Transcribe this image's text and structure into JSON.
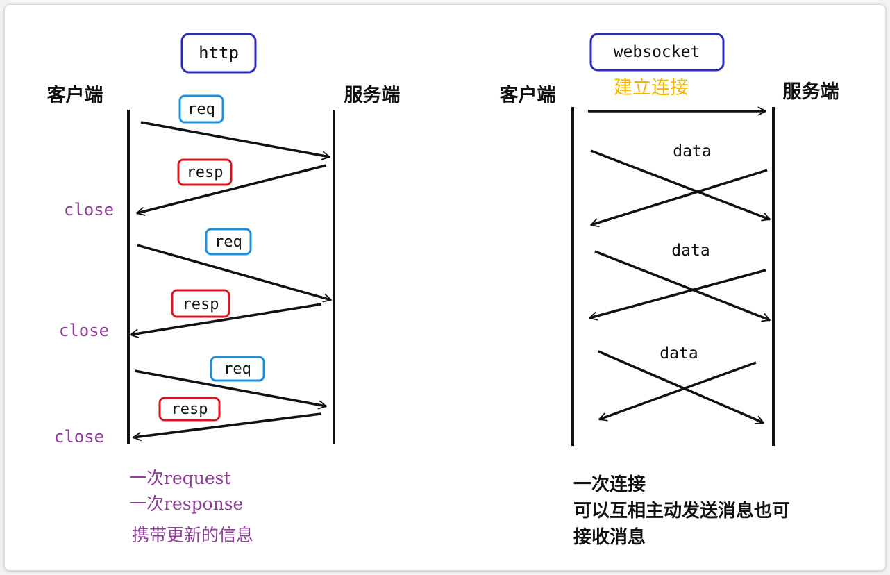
{
  "colors": {
    "line": "#111111",
    "http_box": "#2b2bb8",
    "req_box": "#1e8fe0",
    "resp_box": "#e0141e",
    "close_text": "#8f3b98",
    "connect_text": "#f4b400",
    "note_purple": "#8f3b98"
  },
  "http": {
    "title": "http",
    "client_label": "客户端",
    "server_label": "服务端",
    "req_label": "req",
    "resp_label": "resp",
    "close_label": "close",
    "notes": [
      "一次request",
      "一次response",
      "携带更新的信息"
    ]
  },
  "websocket": {
    "title": "websocket",
    "client_label": "客户端",
    "server_label": "服务端",
    "connect_label": "建立连接",
    "data_label": "data",
    "notes": [
      "一次连接",
      "可以互相主动发送消息也可",
      "接收消息"
    ]
  }
}
